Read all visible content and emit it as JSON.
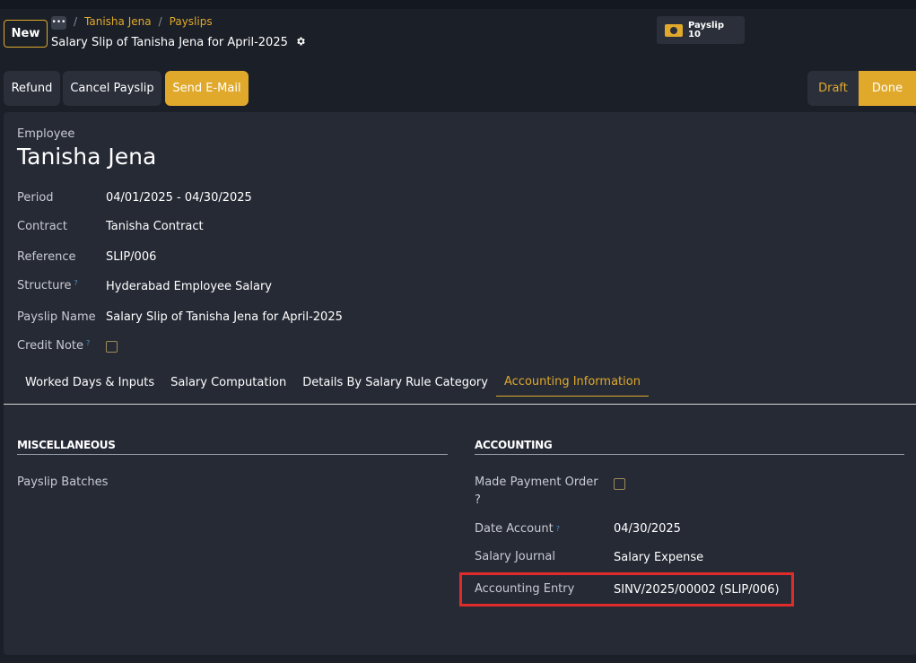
{
  "control_panel": {
    "new_label": "New",
    "more_icon": "ellipsis-icon",
    "breadcrumb": [
      "Tanisha Jena",
      "Payslips"
    ],
    "breadcrumb_sep": "/",
    "record_title": "Salary Slip of Tanisha Jena for April-2025",
    "settings_icon": "gear-icon"
  },
  "smart_button": {
    "icon": "money-icon",
    "label": "Payslip",
    "count": "10"
  },
  "actions": {
    "refund": "Refund",
    "cancel": "Cancel Payslip",
    "send_email": "Send E-Mail"
  },
  "status": {
    "draft": "Draft",
    "done": "Done",
    "active": "Done"
  },
  "form": {
    "employee_label": "Employee",
    "employee_name": "Tanisha Jena",
    "help_mark": "?",
    "fields": {
      "period": {
        "label": "Period",
        "value": "04/01/2025 - 04/30/2025"
      },
      "contract": {
        "label": "Contract",
        "value": "Tanisha Contract"
      },
      "reference": {
        "label": "Reference",
        "value": "SLIP/006"
      },
      "structure": {
        "label": "Structure",
        "value": "Hyderabad Employee Salary"
      },
      "payslip_name": {
        "label": "Payslip Name",
        "value": "Salary Slip of Tanisha Jena for April-2025"
      },
      "credit_note": {
        "label": "Credit Note",
        "checked": false
      }
    }
  },
  "tabs": [
    {
      "label": "Worked Days & Inputs"
    },
    {
      "label": "Salary Computation"
    },
    {
      "label": "Details By Salary Rule Category"
    },
    {
      "label": "Accounting Information"
    }
  ],
  "active_tab": "Accounting Information",
  "accounting_tab": {
    "misc_title": "MISCELLANEOUS",
    "payslip_batches_label": "Payslip Batches",
    "accounting_title": "ACCOUNTING",
    "made_payment_order": {
      "label": "Made Payment Order",
      "checked": false
    },
    "date_account": {
      "label": "Date Account",
      "value": "04/30/2025"
    },
    "salary_journal": {
      "label": "Salary Journal",
      "value": "Salary Expense"
    },
    "accounting_entry": {
      "label": "Accounting Entry",
      "value": "SINV/2025/00002 (SLIP/006)"
    }
  },
  "colors": {
    "accent": "#e0a92c",
    "background": "#1b1f28",
    "sheet": "#262a35",
    "highlight": "#e02b2b"
  }
}
